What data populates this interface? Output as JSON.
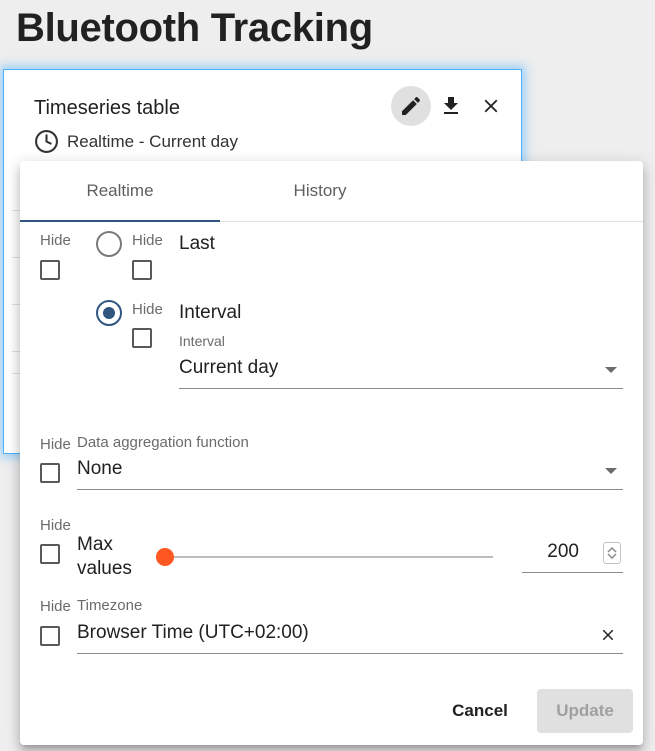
{
  "page": {
    "title": "Bluetooth Tracking"
  },
  "widget": {
    "title": "Timeseries table",
    "subtitle": "Realtime - Current day",
    "icons": [
      "edit-icon",
      "download-icon",
      "close-icon",
      "clock-icon"
    ]
  },
  "timewindow": {
    "tabs": [
      {
        "label": "Realtime",
        "active": true
      },
      {
        "label": "History",
        "active": false
      }
    ],
    "hide_label": "Hide",
    "last": {
      "label": "Last",
      "selected": false,
      "hidden": false
    },
    "interval": {
      "label": "Interval",
      "selected": true,
      "hidden": false,
      "field_label": "Interval",
      "value": "Current day"
    },
    "aggregation": {
      "field_label": "Data aggregation function",
      "value": "None",
      "hidden": false
    },
    "max_values": {
      "label_line1": "Max",
      "label_line2": "values",
      "value": "200",
      "slider_fraction": 0.0,
      "hidden": false
    },
    "timezone": {
      "field_label": "Timezone",
      "value": "Browser Time (UTC+02:00)",
      "hidden": false
    },
    "actions": {
      "cancel": "Cancel",
      "update": "Update"
    }
  },
  "colors": {
    "accent": "#305680",
    "slider_thumb": "#ff5722",
    "widget_glow": "#4fb3ff"
  }
}
